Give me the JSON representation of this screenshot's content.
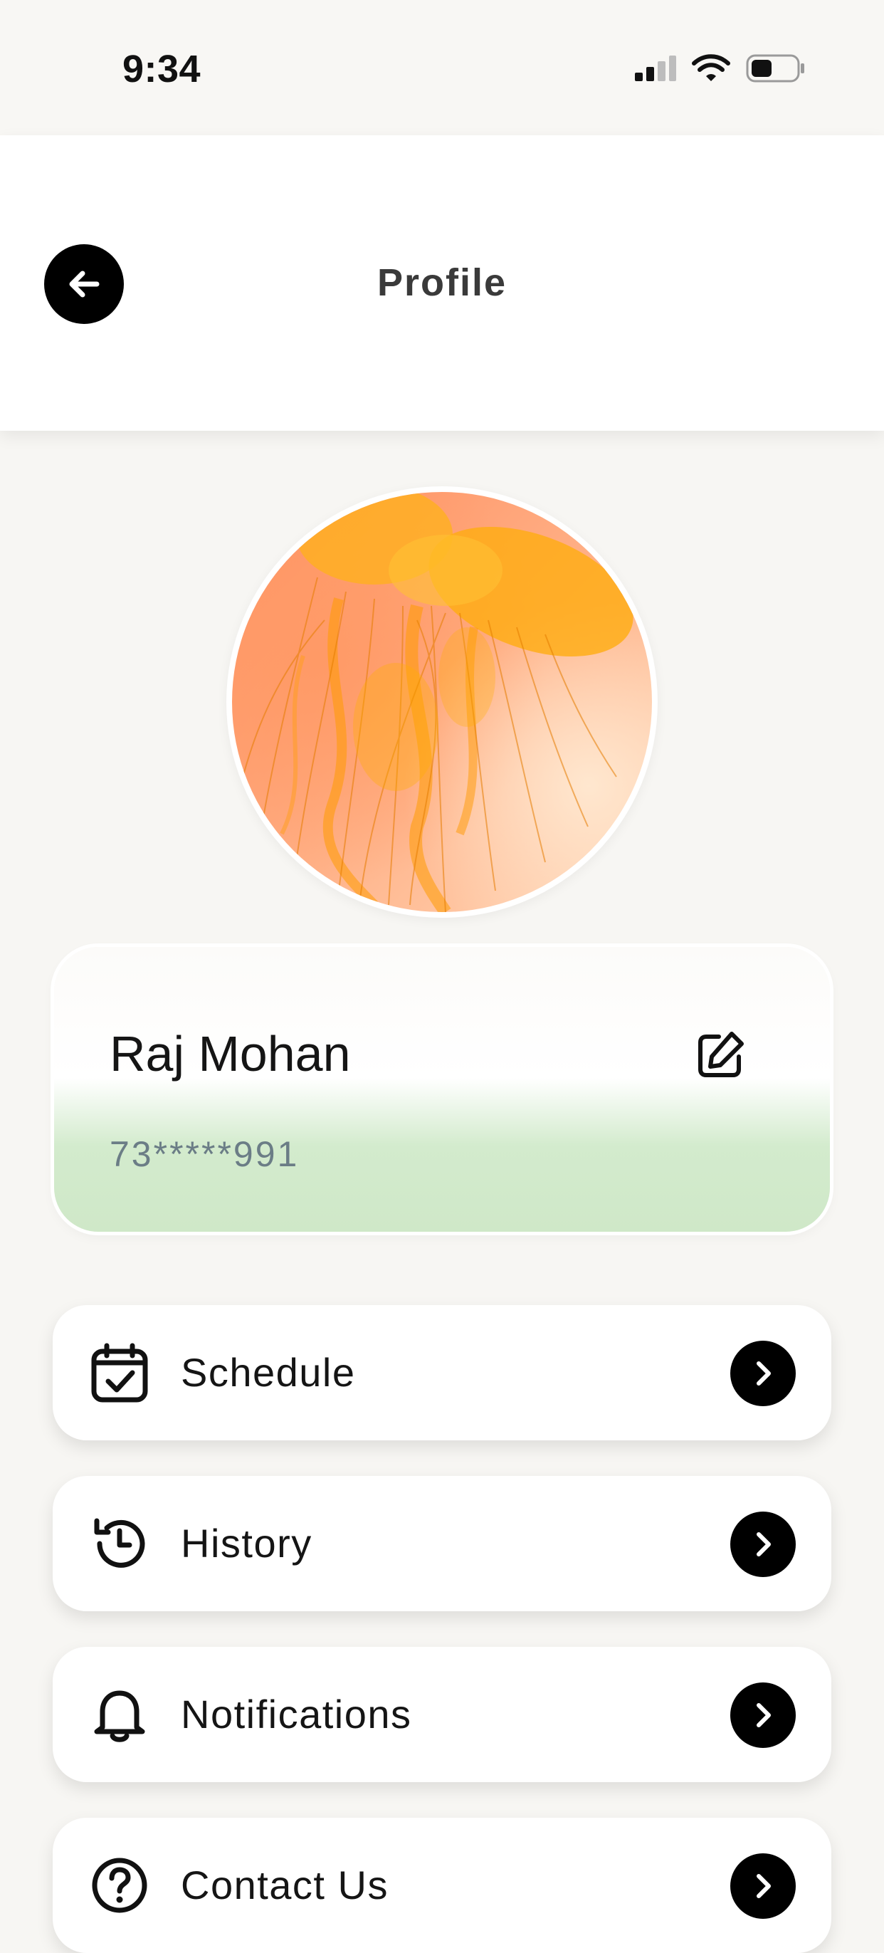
{
  "status_bar": {
    "time": "9:34"
  },
  "header": {
    "title": "Profile"
  },
  "profile": {
    "name": "Raj Mohan",
    "phone": "73*****991"
  },
  "menu": [
    {
      "label": "Schedule",
      "icon": "calendar-check-icon"
    },
    {
      "label": "History",
      "icon": "history-icon"
    },
    {
      "label": "Notifications",
      "icon": "bell-icon"
    },
    {
      "label": "Contact Us",
      "icon": "help-circle-icon"
    }
  ]
}
